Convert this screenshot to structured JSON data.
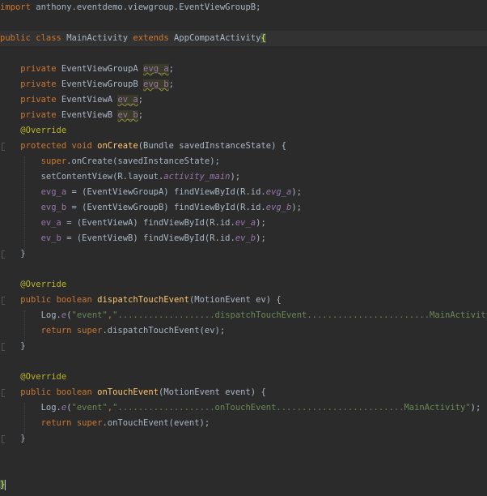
{
  "code": {
    "l01_kw": "import",
    "l01_rest": " anthony.eventdemo.viewgroup.EventViewGroupB;",
    "l03_kw1": "public",
    "l03_kw2": "class",
    "l03_name": "MainActivity",
    "l03_kw3": "extends",
    "l03_super": "AppCompatActivity",
    "l03_brace": "{",
    "l05_kw": "private",
    "l05_type": "EventViewGroupA",
    "l05_field": "evg_a",
    "l06_kw": "private",
    "l06_type": "EventViewGroupB",
    "l06_field": "evg_b",
    "l07_kw": "private",
    "l07_type": "EventViewA",
    "l07_field": "ev_a",
    "l08_kw": "private",
    "l08_type": "EventViewB",
    "l08_field": "ev_b",
    "l09_ann": "@Override",
    "l10_kw1": "protected",
    "l10_kw2": "void",
    "l10_fn": "onCreate",
    "l10_rest": "(Bundle savedInstanceState) {",
    "l11_kw": "super",
    "l11_rest": ".onCreate(savedInstanceState);",
    "l12_a": "setContentView(R.layout.",
    "l12_b": "activity_main",
    "l12_c": ");",
    "l13_a": "evg_a",
    "l13_b": "= (EventViewGroupA) findViewById(R.id.",
    "l13_c": "evg_a",
    "l13_d": ");",
    "l14_a": "evg_b",
    "l14_b": "= (EventViewGroupB) findViewById(R.id.",
    "l14_c": "evg_b",
    "l14_d": ");",
    "l15_a": "ev_a",
    "l15_b": "= (EventViewA) findViewById(R.id.",
    "l15_c": "ev_a",
    "l15_d": ");",
    "l16_a": "ev_b",
    "l16_b": "= (EventViewB) findViewById(R.id.",
    "l16_c": "ev_b",
    "l16_d": ");",
    "l17": "}",
    "l19_ann": "@Override",
    "l20_kw1": "public",
    "l20_kw2": "boolean",
    "l20_fn": "dispatchTouchEvent",
    "l20_rest": "(MotionEvent ev) {",
    "l21_a": "Log.",
    "l21_b": "e",
    "l21_c": "(",
    "l21_s1": "\"event\"",
    "l21_d": ",",
    "l21_s2": "\"...................dispatchTouchEvent........................MainActivity\"",
    "l21_e": ");",
    "l22_kw1": "return",
    "l22_kw2": "super",
    "l22_rest": ".dispatchTouchEvent(ev);",
    "l23": "}",
    "l25_ann": "@Override",
    "l26_kw1": "public",
    "l26_kw2": "boolean",
    "l26_fn": "onTouchEvent",
    "l26_rest": "(MotionEvent event) {",
    "l27_a": "Log.",
    "l27_b": "e",
    "l27_c": "(",
    "l27_s1": "\"event\"",
    "l27_d": ",",
    "l27_s2": "\"...................onTouchEvent.........................MainActivity\"",
    "l27_e": ");",
    "l28_kw1": "return",
    "l28_kw2": "super",
    "l28_rest": ".onTouchEvent(event);",
    "l29": "}",
    "l32": "}"
  }
}
